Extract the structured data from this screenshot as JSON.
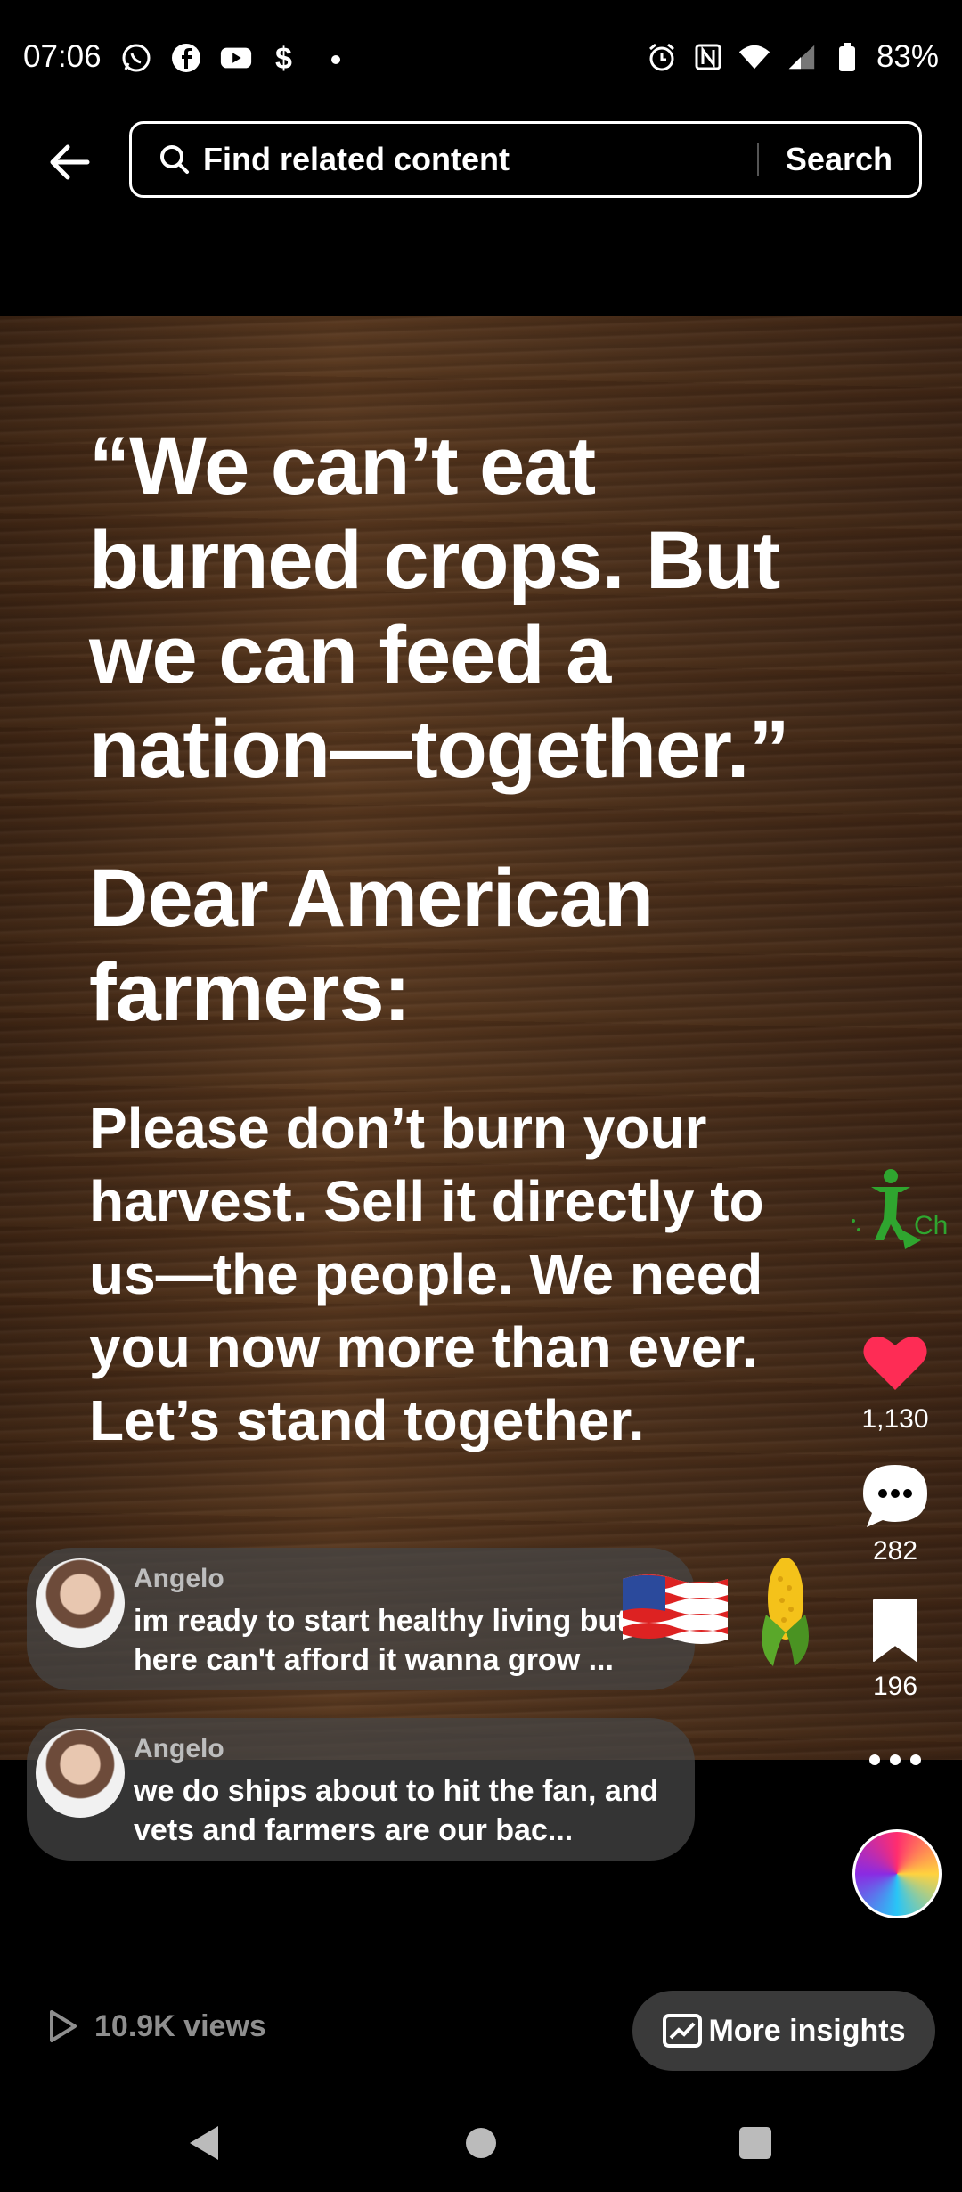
{
  "status_bar": {
    "time": "07:06",
    "battery": "83%",
    "left_icons": [
      "whatsapp-icon",
      "facebook-icon",
      "youtube-icon",
      "cash-app-icon",
      "dot-icon"
    ],
    "right_icons": [
      "alarm-icon",
      "nfc-icon",
      "wifi-icon",
      "signal-icon",
      "battery-icon"
    ]
  },
  "search": {
    "placeholder": "Find related content",
    "button_label": "Search"
  },
  "post": {
    "quote": "“We can’t eat burned crops. But we can feed a nation—together.”",
    "heading": "Dear American farmers:",
    "body": "Please don’t burn your harvest. Sell it directly to us—the people. We need you now more than ever. Let’s stand together."
  },
  "actions": {
    "likes": "1,130",
    "comments": "282",
    "saves": "196"
  },
  "comments": [
    {
      "author": "Angelo",
      "text": "im ready to start healthy living but here can't afford it wanna grow ..."
    },
    {
      "author": "Angelo",
      "text": "we do ships about to hit the fan, and vets and farmers are our bac..."
    }
  ],
  "footer": {
    "views": "10.9K views",
    "insights_label": "More insights"
  },
  "colors": {
    "like_red": "#fe2c55",
    "wood_brown": "#4e321d"
  }
}
